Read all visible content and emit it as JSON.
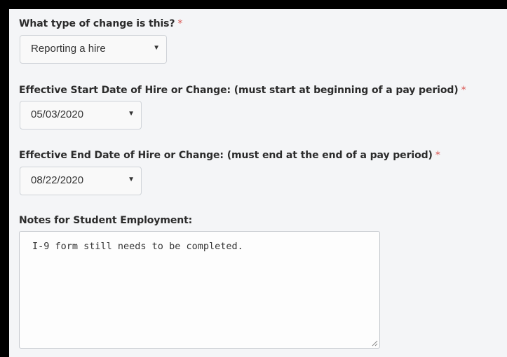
{
  "form": {
    "change_type": {
      "label": "What type of change is this?",
      "required_mark": "*",
      "selected": "Reporting a hire"
    },
    "start_date": {
      "label": "Effective Start Date of Hire or Change: (must start at beginning of a pay period)",
      "required_mark": "*",
      "selected": "05/03/2020"
    },
    "end_date": {
      "label": "Effective End Date of Hire or Change: (must end at the end of a pay period)",
      "required_mark": "*",
      "selected": "08/22/2020"
    },
    "notes": {
      "label": "Notes for Student Employment:",
      "value": "I-9 form still needs to be completed."
    }
  },
  "icons": {
    "dropdown": "triangle-down",
    "resize": "resize-grip"
  },
  "colors": {
    "background": "#f4f5f7",
    "frame": "#000000",
    "required": "#d9534f",
    "label_text": "#2b2b2b"
  }
}
